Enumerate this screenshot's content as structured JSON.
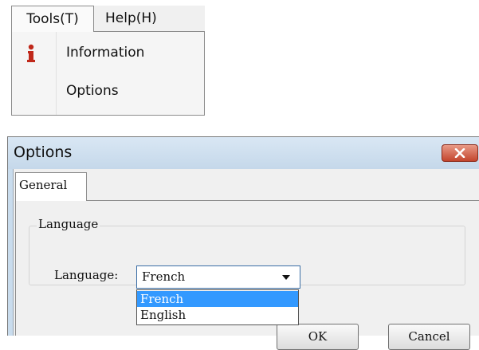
{
  "menubar": {
    "tools_label": "Tools(T)",
    "help_label": "Help(H)",
    "tools_menu": [
      {
        "label": "Information",
        "icon": "info-icon"
      },
      {
        "label": "Options",
        "icon": ""
      }
    ]
  },
  "dialog": {
    "title": "Options",
    "tab_label": "General",
    "group_label": "Language",
    "field_label": "Language:",
    "selected_value": "French",
    "options": [
      "French",
      "English"
    ],
    "ok_label": "OK",
    "cancel_label": "Cancel"
  },
  "colors": {
    "selection": "#3399ff",
    "close_button": "#c3452d",
    "info_icon": "#c0281a"
  }
}
